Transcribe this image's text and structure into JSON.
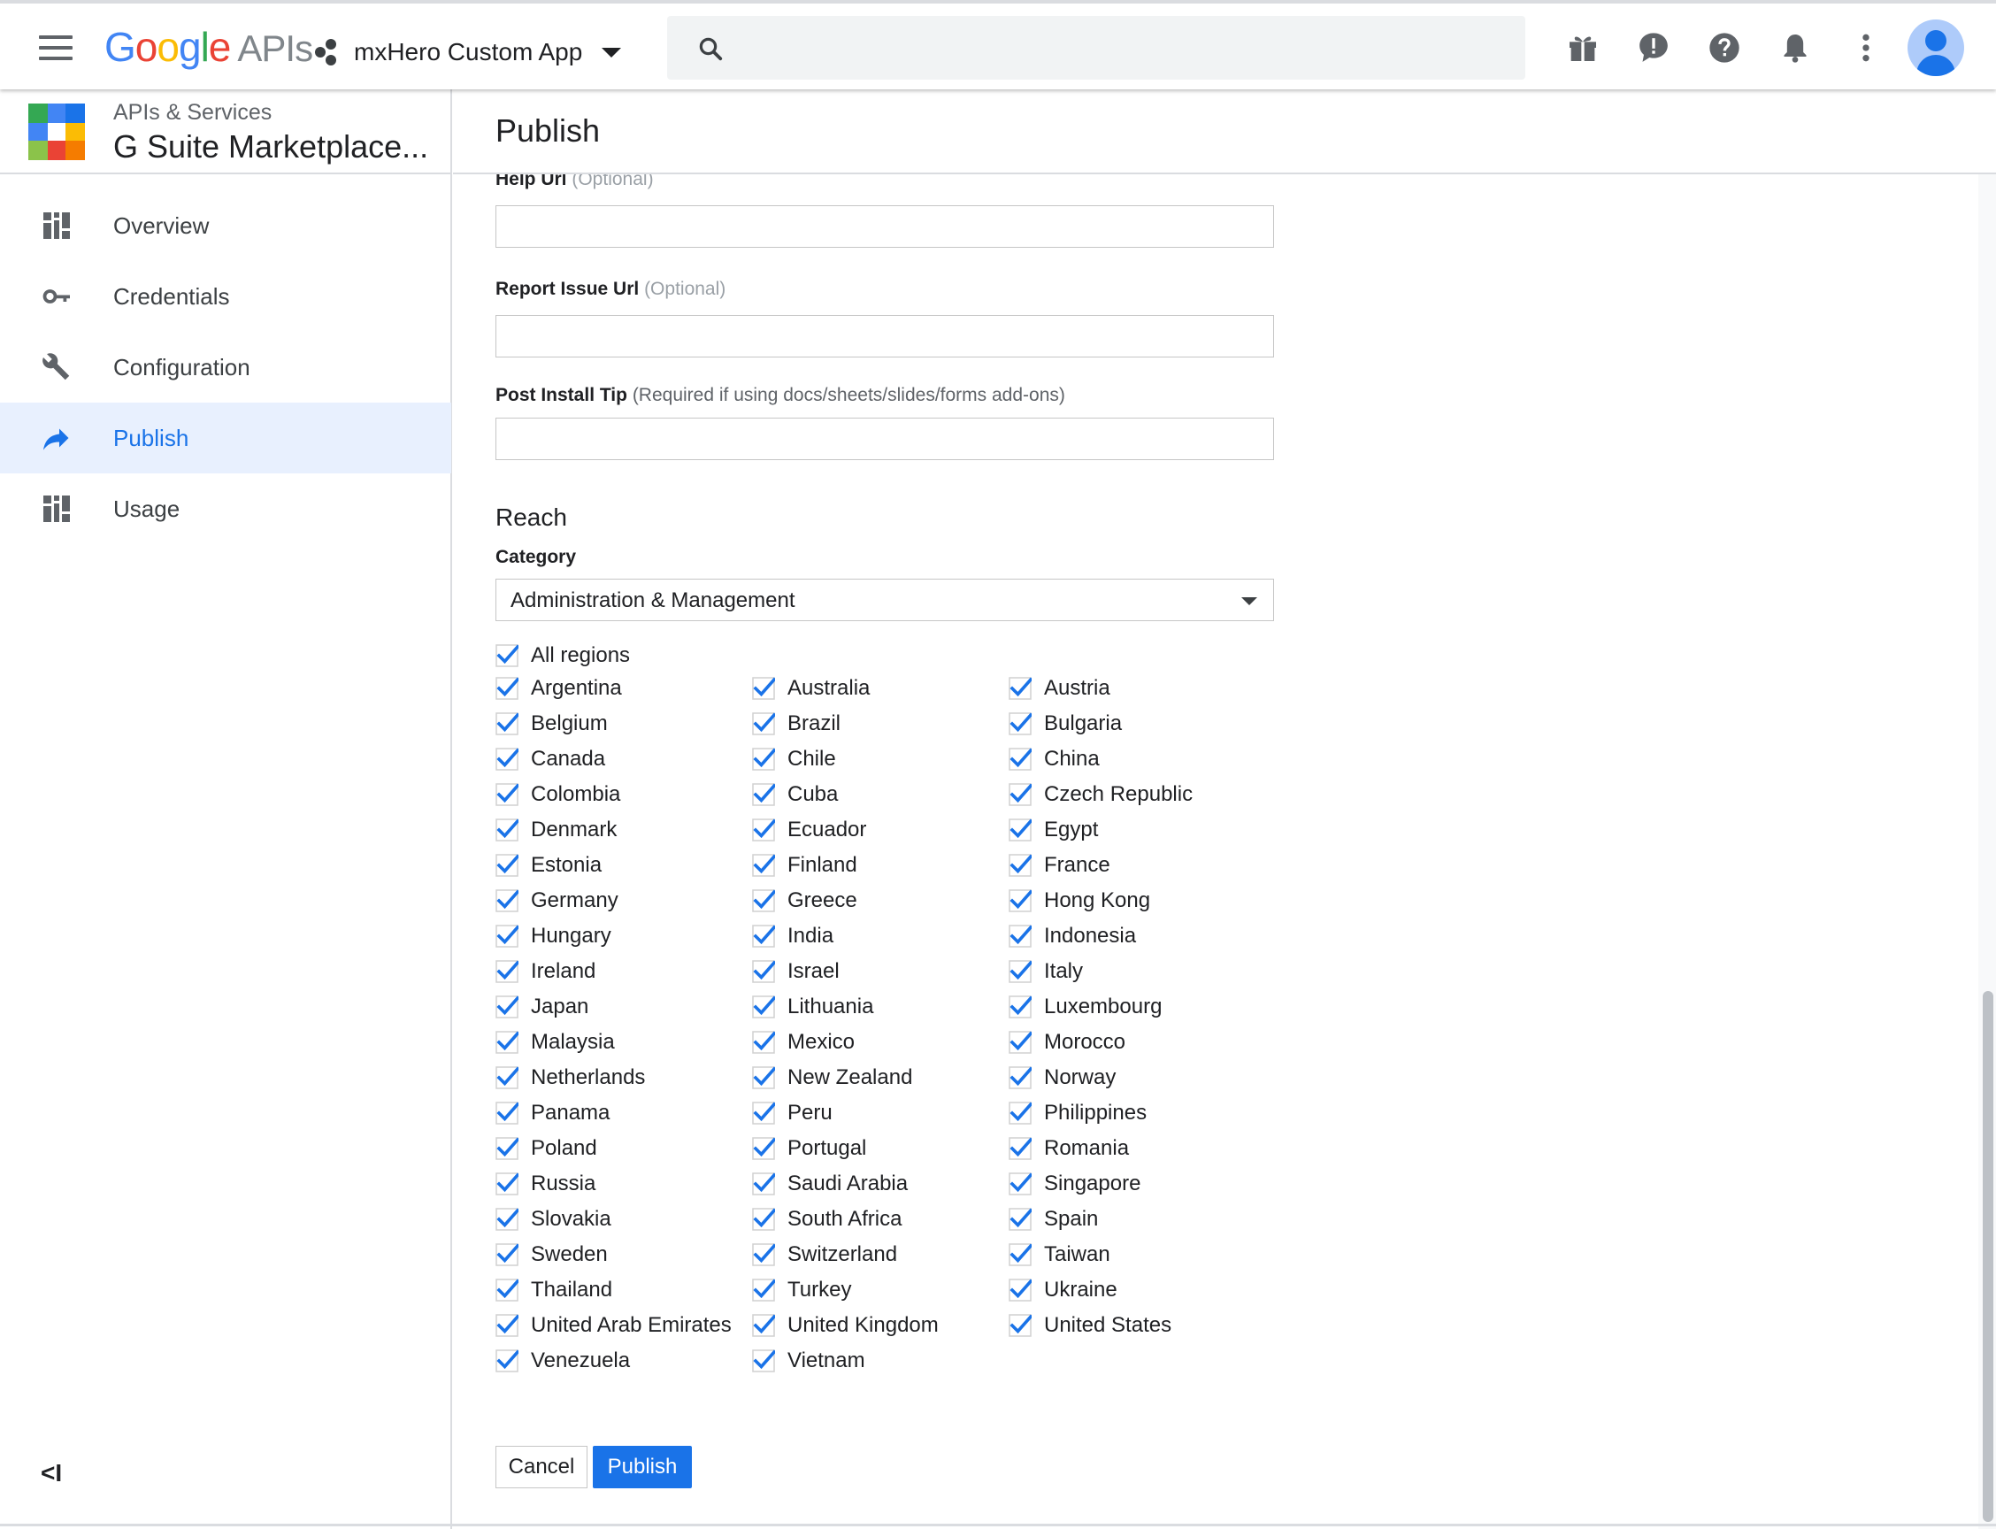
{
  "topbar": {
    "logo_google": "Google",
    "logo_apis": "APIs",
    "project_name": "mxHero Custom App",
    "search_placeholder": ""
  },
  "sidebar": {
    "header_sup": "APIs & Services",
    "header_title": "G Suite Marketplace...",
    "items": [
      {
        "label": "Overview",
        "icon": "dashboard-icon",
        "active": false
      },
      {
        "label": "Credentials",
        "icon": "key-icon",
        "active": false
      },
      {
        "label": "Configuration",
        "icon": "wrench-icon",
        "active": false
      },
      {
        "label": "Publish",
        "icon": "share-arrow-icon",
        "active": true
      },
      {
        "label": "Usage",
        "icon": "dashboard-icon",
        "active": false
      }
    ],
    "collapse_label": "<I"
  },
  "main": {
    "title": "Publish",
    "help_url_label": "Help Url",
    "help_url_optional": "(Optional)",
    "help_url_value": "",
    "report_issue_label": "Report Issue Url",
    "report_issue_optional": "(Optional)",
    "report_issue_value": "",
    "post_install_label": "Post Install Tip",
    "post_install_note": "(Required if using docs/sheets/slides/forms add-ons)",
    "post_install_value": "",
    "reach_heading": "Reach",
    "category_label": "Category",
    "category_value": "Administration & Management",
    "all_regions_label": "All regions",
    "regions": [
      [
        "Argentina",
        "Australia",
        "Austria"
      ],
      [
        "Belgium",
        "Brazil",
        "Bulgaria"
      ],
      [
        "Canada",
        "Chile",
        "China"
      ],
      [
        "Colombia",
        "Cuba",
        "Czech Republic"
      ],
      [
        "Denmark",
        "Ecuador",
        "Egypt"
      ],
      [
        "Estonia",
        "Finland",
        "France"
      ],
      [
        "Germany",
        "Greece",
        "Hong Kong"
      ],
      [
        "Hungary",
        "India",
        "Indonesia"
      ],
      [
        "Ireland",
        "Israel",
        "Italy"
      ],
      [
        "Japan",
        "Lithuania",
        "Luxembourg"
      ],
      [
        "Malaysia",
        "Mexico",
        "Morocco"
      ],
      [
        "Netherlands",
        "New Zealand",
        "Norway"
      ],
      [
        "Panama",
        "Peru",
        "Philippines"
      ],
      [
        "Poland",
        "Portugal",
        "Romania"
      ],
      [
        "Russia",
        "Saudi Arabia",
        "Singapore"
      ],
      [
        "Slovakia",
        "South Africa",
        "Spain"
      ],
      [
        "Sweden",
        "Switzerland",
        "Taiwan"
      ],
      [
        "Thailand",
        "Turkey",
        "Ukraine"
      ],
      [
        "United Arab Emirates",
        "United Kingdom",
        "United States"
      ],
      [
        "Venezuela",
        "Vietnam"
      ]
    ],
    "cancel_label": "Cancel",
    "publish_label": "Publish"
  },
  "colors": {
    "accent": "#1a73e8",
    "active_bg": "#e8f0fe",
    "checkbox": "#1a73e8"
  }
}
